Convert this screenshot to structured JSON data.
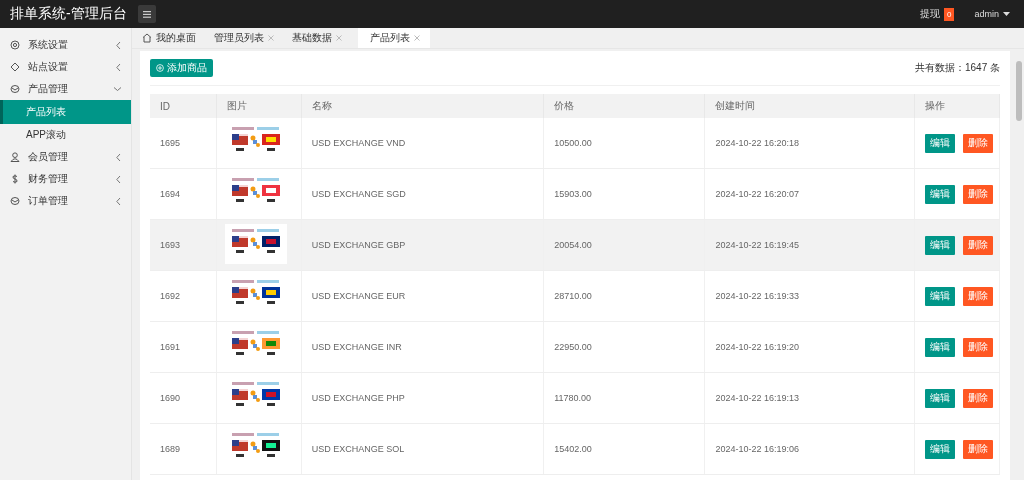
{
  "app": {
    "title": "排单系统-管理后台"
  },
  "header": {
    "withdraw": {
      "label": "提现",
      "badge": "0"
    },
    "user": "admin"
  },
  "sidebar": {
    "items": [
      {
        "label": "系统设置",
        "expanded": false
      },
      {
        "label": "站点设置",
        "expanded": false
      },
      {
        "label": "产品管理",
        "expanded": true,
        "children": [
          {
            "label": "产品列表",
            "selected": true
          },
          {
            "label": "APP滚动",
            "selected": false
          }
        ]
      },
      {
        "label": "会员管理",
        "expanded": false
      },
      {
        "label": "财务管理",
        "expanded": false
      },
      {
        "label": "订单管理",
        "expanded": false
      }
    ]
  },
  "tabs": [
    {
      "label": "我的桌面",
      "kind": "home",
      "selected": false
    },
    {
      "label": "管理员列表",
      "kind": "page",
      "selected": false
    },
    {
      "label": "基础数据",
      "kind": "page",
      "selected": false
    },
    {
      "label": "产品列表",
      "kind": "page",
      "selected": true
    }
  ],
  "toolbar": {
    "add_button": "添加商品",
    "total": "共有数据：1647 条"
  },
  "table": {
    "columns": [
      "ID",
      "图片",
      "名称",
      "价格",
      "创建时间",
      "操作"
    ],
    "rows": [
      {
        "id": "1695",
        "name": "USD EXCHANGE VND",
        "price": "10500.00",
        "created": "2024-10-22 16:20:18",
        "highlighted": false,
        "actions": [
          {
            "label": "编辑",
            "kind": "edit"
          },
          {
            "label": "删除",
            "kind": "delete"
          }
        ]
      },
      {
        "id": "1694",
        "name": "USD EXCHANGE SGD",
        "price": "15903.00",
        "created": "2024-10-22 16:20:07",
        "highlighted": false,
        "actions": [
          {
            "label": "编辑",
            "kind": "edit"
          },
          {
            "label": "删除",
            "kind": "delete"
          }
        ]
      },
      {
        "id": "1693",
        "name": "USD EXCHANGE GBP",
        "price": "20054.00",
        "created": "2024-10-22 16:19:45",
        "highlighted": true,
        "actions": [
          {
            "label": "编辑",
            "kind": "edit"
          },
          {
            "label": "删除",
            "kind": "delete"
          }
        ]
      },
      {
        "id": "1692",
        "name": "USD EXCHANGE EUR",
        "price": "28710.00",
        "created": "2024-10-22 16:19:33",
        "highlighted": false,
        "actions": [
          {
            "label": "编辑",
            "kind": "edit"
          },
          {
            "label": "删除",
            "kind": "delete"
          }
        ]
      },
      {
        "id": "1691",
        "name": "USD EXCHANGE INR",
        "price": "22950.00",
        "created": "2024-10-22 16:19:20",
        "highlighted": false,
        "actions": [
          {
            "label": "编辑",
            "kind": "edit"
          },
          {
            "label": "删除",
            "kind": "delete"
          }
        ]
      },
      {
        "id": "1690",
        "name": "USD EXCHANGE PHP",
        "price": "11780.00",
        "created": "2024-10-22 16:19:13",
        "highlighted": false,
        "actions": [
          {
            "label": "编辑",
            "kind": "edit"
          },
          {
            "label": "删除",
            "kind": "delete"
          }
        ]
      },
      {
        "id": "1689",
        "name": "USD EXCHANGE SOL",
        "price": "15402.00",
        "created": "2024-10-22 16:19:06",
        "highlighted": false,
        "actions": [
          {
            "label": "编辑",
            "kind": "edit"
          },
          {
            "label": "删除",
            "kind": "delete"
          }
        ]
      }
    ]
  }
}
